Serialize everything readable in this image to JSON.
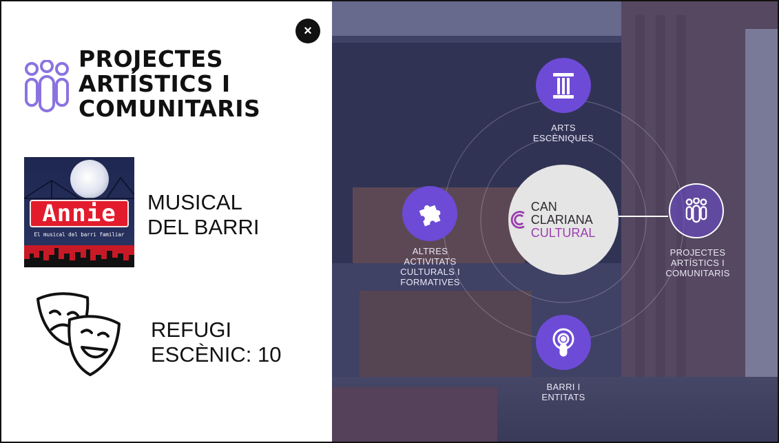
{
  "panel": {
    "title_line1": "PROJECTES",
    "title_line2": "ARTÍSTICS I",
    "title_line3": "COMUNITARIS",
    "close_label": "×",
    "items": [
      {
        "label_line1": "MUSICAL",
        "label_line2": "DEL BARRI",
        "image_title": "Annie",
        "image_subtitle": "El musical del barri familiar"
      },
      {
        "label_line1": "REFUGI",
        "label_line2": "ESCÈNIC: 10",
        "icon": "theater-masks-icon"
      }
    ]
  },
  "map": {
    "center_line1": "CAN CLARIANA",
    "center_line2": "CULTURAL",
    "nodes": [
      {
        "label_line1": "ARTS",
        "label_line2": "ESCÈNIQUES",
        "label_line3": "",
        "label_line4": "",
        "icon": "column-icon"
      },
      {
        "label_line1": "ALTRES",
        "label_line2": "ACTIVITATS",
        "label_line3": "CULTURALS I",
        "label_line4": "FORMATIVES",
        "icon": "puzzle-icon"
      },
      {
        "label_line1": "PROJECTES",
        "label_line2": "ARTÍSTICS I",
        "label_line3": "COMUNITARIS",
        "label_line4": "",
        "icon": "people-icon"
      },
      {
        "label_line1": "BARRI I",
        "label_line2": "ENTITATS",
        "label_line3": "",
        "label_line4": "",
        "icon": "podcast-icon"
      }
    ]
  },
  "colors": {
    "accent": "#6d4bd6",
    "icon_lilac": "#8a73e0",
    "brand_purple": "#9a3fae",
    "annie_red": "#e21c2c"
  }
}
